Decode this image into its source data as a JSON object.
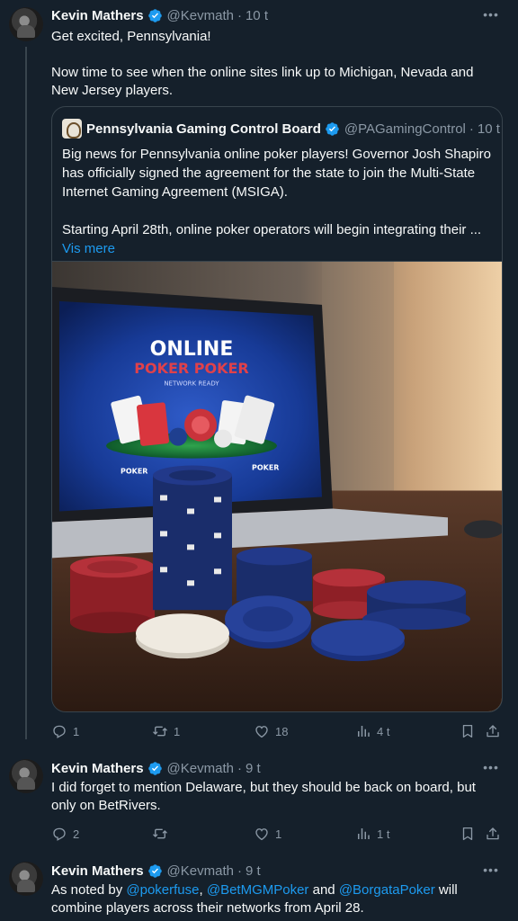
{
  "tweets": [
    {
      "author": "Kevin Mathers",
      "handle": "@Kevmath",
      "time": "10 t",
      "paragraphs": [
        "Get excited, Pennsylvania!",
        "Now time to see when the online sites link up to Michigan, Nevada and New Jersey players."
      ],
      "quote": {
        "author": "Pennsylvania Gaming Control Board",
        "handle": "@PAGamingControl",
        "time": "10 t",
        "paragraphs": [
          "Big news for Pennsylvania online poker players! Governor Josh Shapiro has officially signed the agreement for the state to join the Multi-State Internet Gaming Agreement (MSIGA).",
          "Starting April 28th, online poker operators will begin integrating their ..."
        ],
        "show_more": "Vis mere",
        "image": {
          "screen_title_1": "ONLINE",
          "screen_title_2": "POKER POKER",
          "screen_sub": "NETWORK READY",
          "left_label": "POKER",
          "right_label": "POKER"
        }
      },
      "stats": {
        "replies": "1",
        "reposts": "1",
        "likes": "18",
        "views": "4 t"
      }
    },
    {
      "author": "Kevin Mathers",
      "handle": "@Kevmath",
      "time": "9 t",
      "text": "I did forget to mention Delaware, but they should be back on board, but only on BetRivers.",
      "stats": {
        "replies": "2",
        "reposts": "",
        "likes": "1",
        "views": "1 t"
      }
    },
    {
      "author": "Kevin Mathers",
      "handle": "@Kevmath",
      "time": "9 t",
      "segments": {
        "s1": "As noted by ",
        "m1": "@pokerfuse",
        "s2": ", ",
        "m2": "@BetMGMPoker",
        "s3": " and ",
        "m3": "@BorgataPoker",
        "s4": " will combine players across their networks  from April 28."
      }
    }
  ],
  "colors": {
    "background": "#15202b",
    "text": "#f7f9f9",
    "secondary": "#8b98a5",
    "accent": "#1d9bf0",
    "border": "#38444d"
  },
  "icons": [
    "verified-badge-icon",
    "more-icon",
    "reply-icon",
    "repost-icon",
    "like-icon",
    "views-icon",
    "bookmark-icon",
    "share-icon"
  ]
}
